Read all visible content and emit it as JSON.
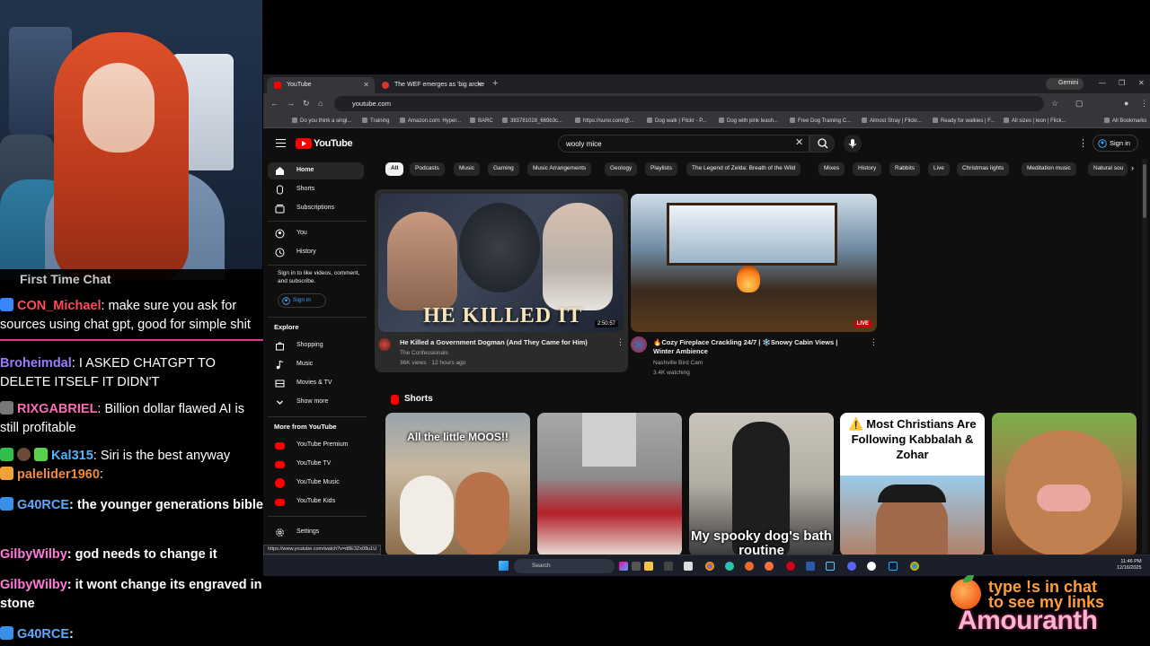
{
  "chat": {
    "first_time_label": "First Time Chat",
    "messages": [
      {
        "user": "CON_Michael",
        "text": ": make sure you ask for sources using chat gpt, good for simple shit",
        "color": "#ff4a5a"
      },
      {
        "user": "Broheimdal",
        "text": ": I ASKED CHATGPT TO DELETE ITSELF IT DIDN'T",
        "color": "#9d7bff"
      },
      {
        "user": "RIXGABRIEL",
        "text": ": Billion dollar flawed AI is still profitable",
        "color": "#ff6bb5"
      },
      {
        "user": "Kal315",
        "text": ": Siri is the best anyway",
        "color": "#4fb3ff"
      },
      {
        "user": "palelider1960",
        "text": ":",
        "color": "#f08a3a"
      },
      {
        "user": "G40RCE",
        "text": ": the younger generations bible",
        "color": "#5aa8ff"
      },
      {
        "user": "GilbyWilby",
        "text": ": god needs to change it",
        "color": "#ff7ad9"
      },
      {
        "user": "GilbyWilby",
        "text": ": it wont change its engraved in stone",
        "color": "#ff7ad9"
      },
      {
        "user": "G40RCE",
        "text": ":",
        "color": "#5aa8ff"
      }
    ]
  },
  "browser": {
    "tabs": [
      {
        "label": "YouTube",
        "active": true,
        "fav_color": "#ff0000"
      },
      {
        "label": "The WEF emerges as 'big arche",
        "active": false,
        "fav_color": "#d9342b"
      }
    ],
    "new_tab": "+",
    "gemini": "Gemini",
    "url": "youtube.com",
    "bookmarks": [
      "Do you think a singl...",
      "Training",
      "Amazon.com: Hyper...",
      "BARC",
      "383781028_669b3c...",
      "https://suno.com/@...",
      "Dog walk | Flickr - P...",
      "Dog with pink leash...",
      "Free Dog Training C...",
      "Almost Stray | Flickr...",
      "Ready for walkies | F...",
      "All sizes | leon | Flick...",
      "All Bookmarks"
    ],
    "status_url": "https://www.youtube.com/watch?v=d8E3Zx08u1U"
  },
  "youtube": {
    "logo": "YouTube",
    "search_value": "wooly mice",
    "signin": "Sign in",
    "sidebar": {
      "items": [
        {
          "label": "Home",
          "icon": "home-icon"
        },
        {
          "label": "Shorts",
          "icon": "shorts-icon"
        },
        {
          "label": "Subscriptions",
          "icon": "subscriptions-icon"
        },
        {
          "label": "You",
          "icon": "you-icon"
        },
        {
          "label": "History",
          "icon": "history-icon"
        }
      ],
      "signin_note": "Sign in to like videos, comment, and subscribe.",
      "signin_button": "Sign in",
      "explore_title": "Explore",
      "explore": [
        "Shopping",
        "Music",
        "Movies & TV",
        "Show more"
      ],
      "more_title": "More from YouTube",
      "more": [
        "YouTube Premium",
        "YouTube TV",
        "YouTube Music",
        "YouTube Kids"
      ],
      "settings": "Settings"
    },
    "chips": [
      "All",
      "Podcasts",
      "Music",
      "Gaming",
      "Music Arrangements",
      "Geology",
      "Playlists",
      "The Legend of Zelda: Breath of the Wild",
      "Mixes",
      "History",
      "Rabbits",
      "Live",
      "Christmas lights",
      "Meditation music",
      "Natural sou"
    ],
    "videos": [
      {
        "title": "He Killed a Government Dogman (And They Came for Him)",
        "channel": "The Confessionals",
        "meta": "36K views · 12 hours ago",
        "duration": "2:50:57",
        "thumb_text": "HE KILLED IT"
      },
      {
        "title": "🔥Cozy Fireplace Crackling 24/7 | ❄️Snowy Cabin Views | Winter Ambience",
        "channel": "Nashville Bird Cam",
        "meta": "3.4K watching",
        "badge": "LIVE"
      }
    ],
    "shorts_title": "Shorts",
    "shorts": [
      {
        "caption": "All the little MOOS!!"
      },
      {
        "caption": ""
      },
      {
        "caption": "My spooky dog's bath routine"
      },
      {
        "caption": "⚠️ Most Christians Are Following Kabbalah & Zohar"
      },
      {
        "caption": ""
      }
    ]
  },
  "taskbar": {
    "search": "Search",
    "time": "11:46 PM",
    "date": "12/16/2025"
  },
  "overlay": {
    "line1": "type !s in chat",
    "line2": "to see my links",
    "brand": "Amouranth"
  }
}
